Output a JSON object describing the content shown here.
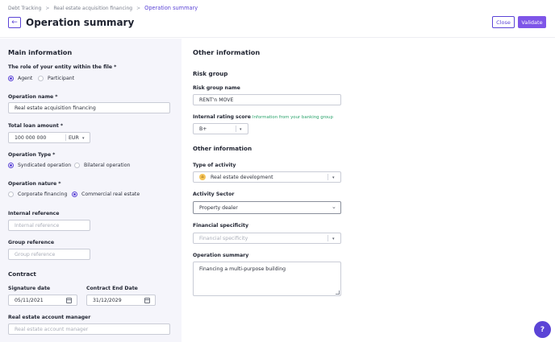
{
  "breadcrumb": {
    "items": [
      "Debt Tracking",
      "Real estate acquisition financing"
    ],
    "current": "Operation summary",
    "separator": ">"
  },
  "header": {
    "title": "Operation summary",
    "back_icon": "←",
    "close_label": "Close",
    "validate_label": "Validate"
  },
  "main": {
    "title": "Main information",
    "role": {
      "label": "The role of your entity within the file",
      "required": "*",
      "options": [
        "Agent",
        "Participant"
      ],
      "selected": "Agent"
    },
    "operation_name": {
      "label": "Operation name",
      "required": "*",
      "value": "Real estate acquisition financing"
    },
    "total_loan": {
      "label": "Total loan amount",
      "required": "*",
      "value": "100 000 000",
      "currency": "EUR"
    },
    "operation_type": {
      "label": "Operation Type",
      "required": "*",
      "options": [
        "Syndicated operation",
        "Bilateral operation"
      ],
      "selected": "Syndicated operation"
    },
    "operation_nature": {
      "label": "Operation nature",
      "required": "*",
      "options": [
        "Corporate financing",
        "Commercial real estate"
      ],
      "selected": "Commercial real estate"
    },
    "internal_reference": {
      "label": "Internal reference",
      "placeholder": "Internal reference"
    },
    "group_reference": {
      "label": "Group reference",
      "placeholder": "Group reference"
    }
  },
  "contract": {
    "title": "Contract",
    "signature_date": {
      "label": "Signature date",
      "value": "05/11/2021"
    },
    "end_date": {
      "label": "Contract End Date",
      "value": "31/12/2029"
    },
    "account_manager": {
      "label": "Real estate account manager",
      "placeholder": "Real estate account manager"
    }
  },
  "other": {
    "title": "Other information",
    "risk_group": {
      "title": "Risk group",
      "name_label": "Risk group name",
      "name_value": "RENT'n MOVE",
      "rating_label": "Internal rating score",
      "rating_hint": "Information from your banking group",
      "rating_value": "B+"
    },
    "other_info": {
      "title": "Other information",
      "activity_label": "Type of activity",
      "activity_value": "Real estate development",
      "sector_label": "Activity Sector",
      "sector_value": "Property dealer",
      "specificity_label": "Financial specificity",
      "specificity_placeholder": "Financial specificity",
      "summary_label": "Operation summary",
      "summary_value": "Financing a multi-purpose building"
    }
  },
  "help": {
    "label": "?"
  },
  "icons": {
    "caret": "▾",
    "chevron": "⌄",
    "activity": "⌂"
  },
  "colors": {
    "accent": "#5b44d6",
    "validate": "#7e55e8",
    "hint": "#2aa36b",
    "panel": "#f5f5fb"
  }
}
